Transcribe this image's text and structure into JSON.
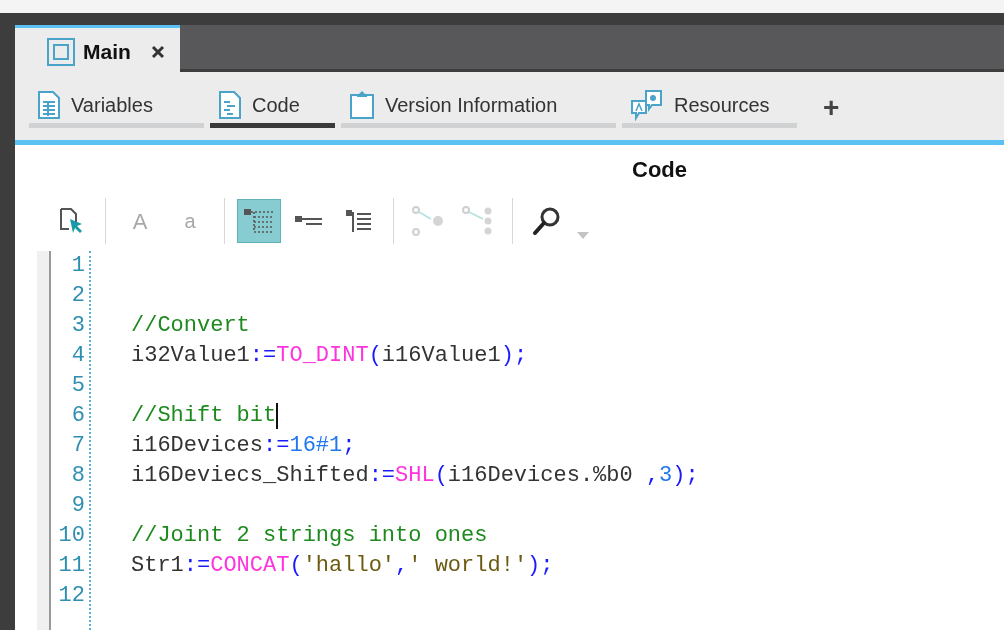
{
  "document_tab": {
    "label": "Main",
    "selected": true
  },
  "view_tabs": [
    {
      "label": "Variables",
      "kind": "table",
      "selected": false
    },
    {
      "label": "Code",
      "kind": "code",
      "selected": true
    },
    {
      "label": "Version Information",
      "kind": "clipboard",
      "selected": false
    },
    {
      "label": "Resources",
      "kind": "resources",
      "selected": false
    }
  ],
  "add_tab": "+",
  "panel_title": "Code",
  "toolbar": [
    [
      {
        "kind": "select-file",
        "disabled": false,
        "selected": false
      }
    ],
    [
      {
        "kind": "text",
        "text": "A",
        "disabled": true,
        "selected": false
      },
      {
        "kind": "text-small",
        "text": "a",
        "disabled": true,
        "selected": false
      }
    ],
    [
      {
        "kind": "tree",
        "disabled": false,
        "selected": true
      },
      {
        "kind": "list",
        "disabled": false,
        "selected": false
      },
      {
        "kind": "lines",
        "disabled": false,
        "selected": false
      }
    ],
    [
      {
        "kind": "connect",
        "disabled": true,
        "selected": false
      },
      {
        "kind": "connect-multi",
        "disabled": true,
        "selected": false
      }
    ],
    [
      {
        "kind": "search",
        "disabled": false,
        "selected": false
      },
      {
        "kind": "caret",
        "disabled": true,
        "selected": false
      }
    ]
  ],
  "code_lines": [
    {
      "number": "1"
    },
    {
      "number": "2"
    },
    {
      "number": "3",
      "tokens": [
        {
          "kind": "comment",
          "text": "//Convert"
        }
      ]
    },
    {
      "number": "4",
      "tokens": [
        {
          "kind": "plain",
          "text": "i32Value1"
        },
        {
          "kind": "op",
          "text": ":="
        },
        {
          "kind": "func",
          "text": "TO_DINT"
        },
        {
          "kind": "op",
          "text": "("
        },
        {
          "kind": "plain",
          "text": "i16Value1"
        },
        {
          "kind": "op",
          "text": ");"
        }
      ]
    },
    {
      "number": "5"
    },
    {
      "number": "6",
      "tokens": [
        {
          "kind": "comment",
          "text": "//Shift bit"
        }
      ],
      "cursor": true
    },
    {
      "number": "7",
      "tokens": [
        {
          "kind": "plain",
          "text": "i16Devices"
        },
        {
          "kind": "op",
          "text": ":="
        },
        {
          "kind": "num",
          "text": "16#1"
        },
        {
          "kind": "op",
          "text": ";"
        }
      ]
    },
    {
      "number": "8",
      "tokens": [
        {
          "kind": "plain",
          "text": "i16Deviecs_Shifted"
        },
        {
          "kind": "op",
          "text": ":="
        },
        {
          "kind": "func",
          "text": "SHL"
        },
        {
          "kind": "op",
          "text": "("
        },
        {
          "kind": "plain",
          "text": "i16Devices.%b0 "
        },
        {
          "kind": "op",
          "text": ","
        },
        {
          "kind": "num",
          "text": "3"
        },
        {
          "kind": "op",
          "text": ");"
        }
      ]
    },
    {
      "number": "9"
    },
    {
      "number": "10",
      "tokens": [
        {
          "kind": "comment",
          "text": "//Joint 2 strings into ones"
        }
      ]
    },
    {
      "number": "11",
      "tokens": [
        {
          "kind": "plain",
          "text": "Str1"
        },
        {
          "kind": "op",
          "text": ":="
        },
        {
          "kind": "func",
          "text": "CONCAT"
        },
        {
          "kind": "op",
          "text": "("
        },
        {
          "kind": "str",
          "text": "'hallo'"
        },
        {
          "kind": "op",
          "text": ","
        },
        {
          "kind": "str",
          "text": "' world!'"
        },
        {
          "kind": "op",
          "text": ");"
        }
      ]
    },
    {
      "number": "12"
    }
  ]
}
